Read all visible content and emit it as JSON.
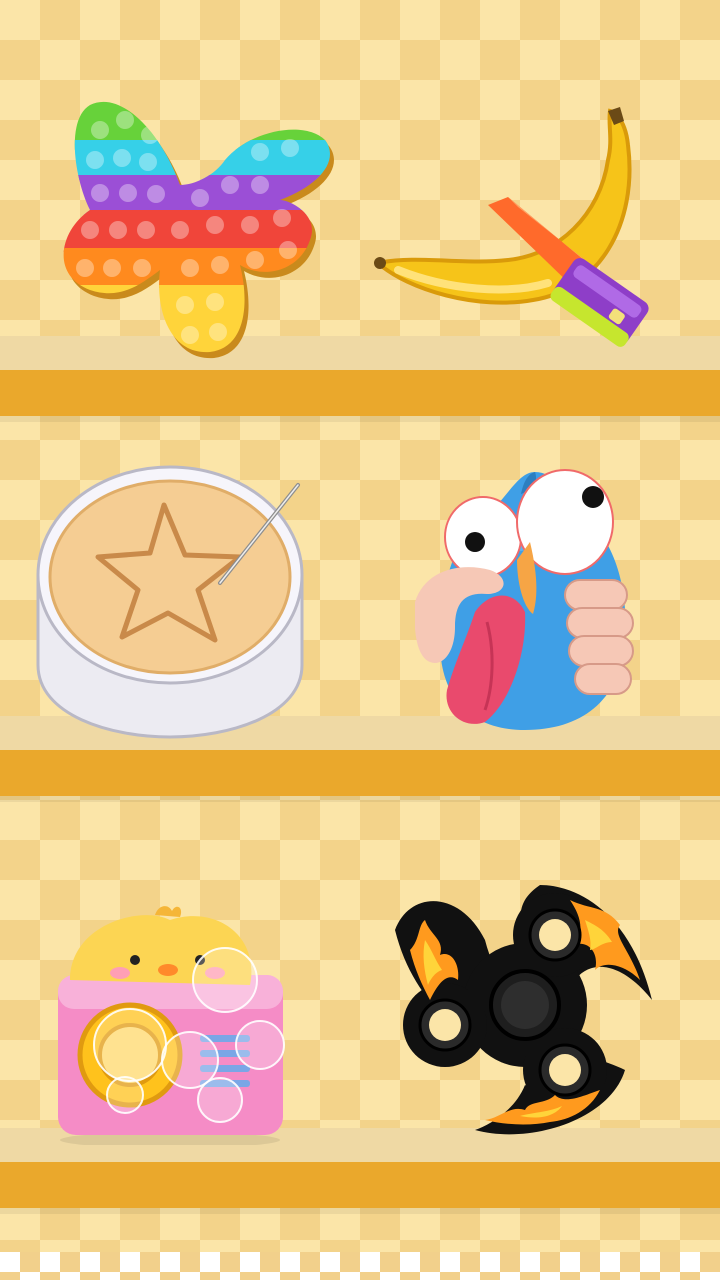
{
  "screen": "toy-shelf-selection",
  "shelves": [
    {
      "items": [
        {
          "id": "rainbow-butterfly-pop-it",
          "icon": "butterfly-pop-it-icon"
        },
        {
          "id": "banana-knife",
          "icon": "banana-knife-icon"
        }
      ]
    },
    {
      "items": [
        {
          "id": "dalgona-star-candy",
          "icon": "dalgona-star-icon"
        },
        {
          "id": "squeeze-bird",
          "icon": "squeeze-bird-icon"
        }
      ]
    },
    {
      "items": [
        {
          "id": "chick-bubble-machine",
          "icon": "bubble-machine-icon"
        },
        {
          "id": "flame-fidget-spinner",
          "icon": "fidget-spinner-icon"
        }
      ]
    }
  ],
  "colors": {
    "shelf_front": "#eaa82c",
    "shelf_top": "#efd9a4",
    "wall_light": "#fbe5a8",
    "wall_dark": "#f3d38a"
  }
}
